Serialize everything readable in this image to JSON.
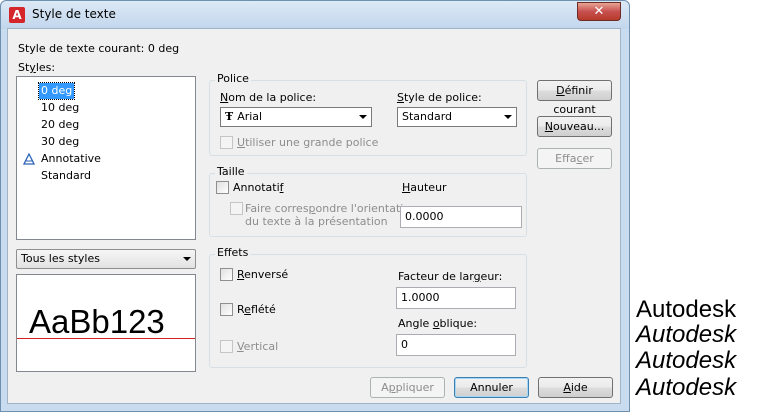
{
  "window": {
    "app_icon_glyph": "A",
    "title": "Style de texte",
    "close_glyph": "✕"
  },
  "current_style": {
    "label": "Style de texte courant: 0 deg"
  },
  "styles": {
    "label_prefix": "St",
    "label_accel": "y",
    "label_suffix": "les:",
    "items": [
      "0 deg",
      "10 deg",
      "20 deg",
      "30 deg",
      "Annotative",
      "Standard"
    ],
    "selected_index": 0,
    "annotative_icon": "annotative-icon",
    "filter_value": "Tous les styles"
  },
  "preview": {
    "text": "AaBb123",
    "baseline_color": "#d41f1f"
  },
  "police": {
    "group_label": "Police",
    "font_name_label_accel": "N",
    "font_name_label_rest": "om de la police:",
    "font_name_value": "Arial",
    "font_style_label_accel": "S",
    "font_style_label_rest": "tyle de police:",
    "font_style_value": "Standard",
    "big_font_label_accel": "U",
    "big_font_label_rest": "tiliser une grande police"
  },
  "taille": {
    "group_label": "Taille",
    "annotative_label_pre": "Annotati",
    "annotative_label_accel": "f",
    "match_label_pre": "Faire corres",
    "match_label_accel": "p",
    "match_label_post": "ondre l'orientation",
    "match_label_line2": "du texte à la présentation",
    "height_label_accel": "H",
    "height_label_rest": "auteur",
    "height_value": "0.0000"
  },
  "effets": {
    "group_label": "Effets",
    "upside_accel": "R",
    "upside_rest": "enversé",
    "backwards_pre": "R",
    "backwards_accel": "e",
    "backwards_post": "flété",
    "vertical_accel": "V",
    "vertical_rest": "ertical",
    "width_label_pre": "Facteur de lar",
    "width_label_accel": "g",
    "width_label_post": "eur:",
    "width_value": "1.0000",
    "oblique_label_pre": "Angle ",
    "oblique_label_accel": "o",
    "oblique_label_post": "blique:",
    "oblique_value": "0"
  },
  "buttons": {
    "set_current_accel": "D",
    "set_current_rest": "éfinir courant",
    "new_accel": "N",
    "new_rest": "ouveau...",
    "delete_pre": "Effa",
    "delete_accel": "c",
    "delete_post": "er",
    "apply_pre": "A",
    "apply_accel": "p",
    "apply_post": "pliquer",
    "cancel": "Annuler",
    "help_accel": "A",
    "help_rest": "ide"
  },
  "samples": [
    "Autodesk",
    "Autodesk",
    "Autodesk",
    "Autodesk"
  ],
  "colors": {
    "selection": "#3399ff",
    "close_button": "#c75050",
    "app_icon": "#d4262b"
  }
}
